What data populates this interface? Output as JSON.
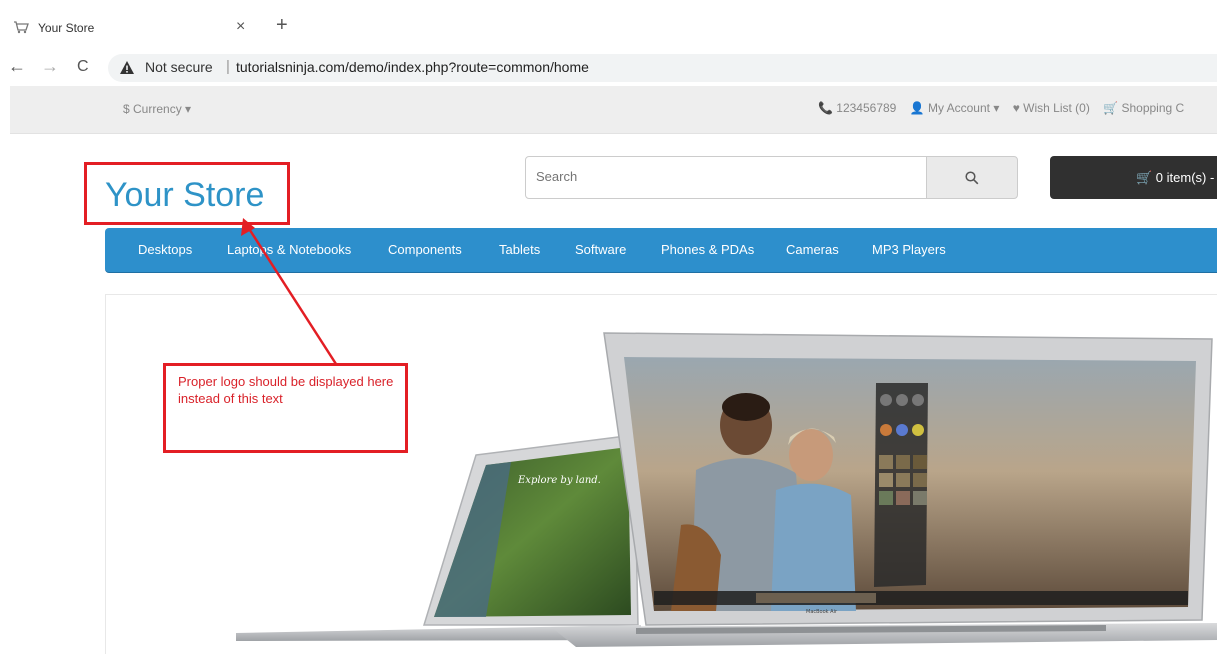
{
  "browser": {
    "tab_title": "Your Store",
    "tab_close": "×",
    "new_tab": "+",
    "back": "←",
    "forward": "→",
    "reload": "C",
    "security_label": "Not secure",
    "url_separator": "|",
    "url": "tutorialsninja.com/demo/index.php?route=common/home"
  },
  "top_bar": {
    "currency_label": "$ Currency ▾",
    "phone": "📞 123456789",
    "my_account": "👤 My Account ▾",
    "wish_list": "♥ Wish List (0)",
    "shopping_cart": "🛒 Shopping C"
  },
  "header": {
    "logo_text": "Your Store",
    "search_placeholder": "Search",
    "search_icon": "search-icon",
    "cart_label": "🛒 0 item(s) -"
  },
  "menu": {
    "items": [
      "Desktops",
      "Laptops & Notebooks",
      "Components",
      "Tablets",
      "Software",
      "Phones & PDAs",
      "Cameras",
      "MP3 Players"
    ]
  },
  "annotation": {
    "note": "Proper logo should be displayed here instead of this text",
    "color": "#e31e24"
  },
  "banner": {
    "small_laptop_text": "Explore by land.",
    "brand_label": "MacBook Air"
  },
  "colors": {
    "menu_blue": "#2d8fcc",
    "logo_blue": "#2e93c7",
    "cart_dark": "#303030"
  }
}
